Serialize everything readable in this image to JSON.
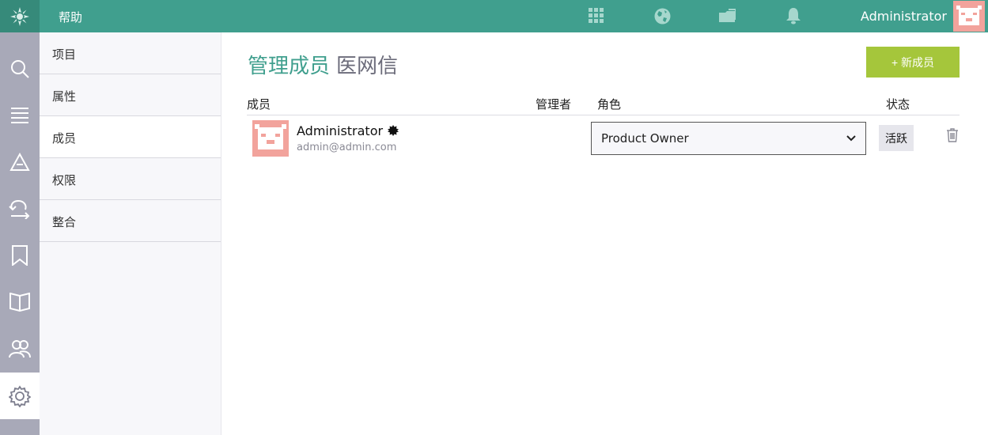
{
  "topbar": {
    "help_label": "帮助",
    "user_name": "Administrator",
    "icons": [
      "apps-grid-icon",
      "globe-icon",
      "folder-icon",
      "bell-icon"
    ]
  },
  "sidebar_icons": [
    "search-icon",
    "list-icon",
    "triangle-icon",
    "cycle-icon",
    "bookmark-icon",
    "book-icon",
    "users-icon",
    "settings-icon"
  ],
  "subnav": {
    "items": [
      {
        "label": "项目"
      },
      {
        "label": "属性"
      },
      {
        "label": "成员"
      },
      {
        "label": "权限"
      },
      {
        "label": "整合"
      }
    ],
    "active_index": 2
  },
  "main": {
    "title_primary": "管理成员",
    "title_secondary": "医网信",
    "add_button": "+ 新成员",
    "columns": {
      "member": "成员",
      "admin": "管理者",
      "role": "角色",
      "status": "状态"
    },
    "rows": [
      {
        "name": "Administrator",
        "email": "admin@admin.com",
        "role": "Product Owner",
        "status": "活跃"
      }
    ]
  },
  "colors": {
    "topbar": "#409f8e",
    "accent_green": "#a5c63b",
    "iconbar": "#a8a9b8",
    "avatar": "#f2a39c"
  }
}
